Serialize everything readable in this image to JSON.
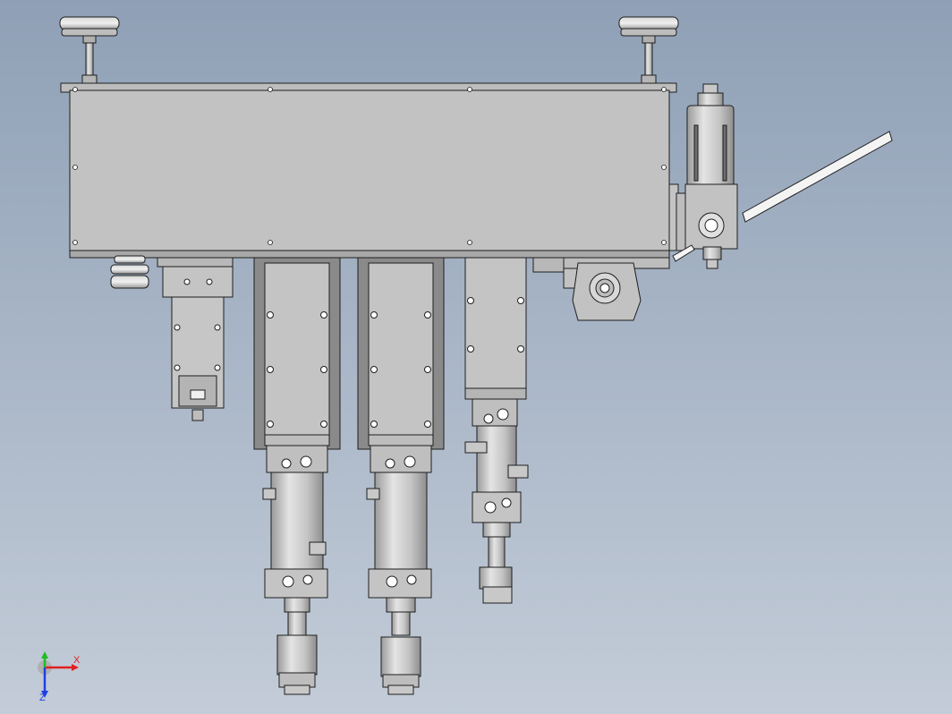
{
  "viewport": {
    "background_top": "#8fa0b6",
    "background_bottom": "#c3ccd8",
    "part_fill": "#c2c2c2",
    "part_dark": "#8a8a8a",
    "edge_color": "#1e1e1e"
  },
  "triad": {
    "x_label": "X",
    "z_label": "Z",
    "x_color": "#e02020",
    "y_color": "#22bb22",
    "z_color": "#2040e0"
  }
}
